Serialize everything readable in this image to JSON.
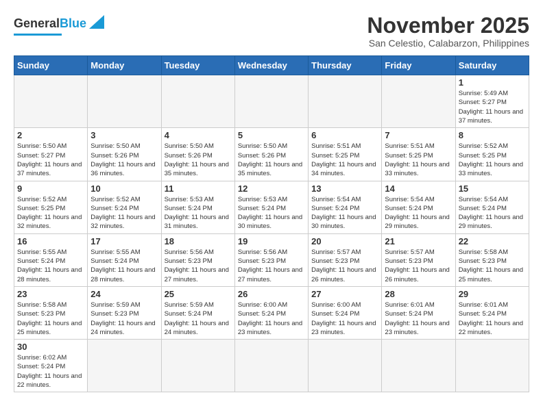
{
  "logo": {
    "text_general": "General",
    "text_blue": "Blue"
  },
  "title": "November 2025",
  "subtitle": "San Celestio, Calabarzon, Philippines",
  "weekdays": [
    "Sunday",
    "Monday",
    "Tuesday",
    "Wednesday",
    "Thursday",
    "Friday",
    "Saturday"
  ],
  "weeks": [
    [
      {
        "day": "",
        "empty": true
      },
      {
        "day": "",
        "empty": true
      },
      {
        "day": "",
        "empty": true
      },
      {
        "day": "",
        "empty": true
      },
      {
        "day": "",
        "empty": true
      },
      {
        "day": "",
        "empty": true
      },
      {
        "day": "1",
        "sunrise": "5:49 AM",
        "sunset": "5:27 PM",
        "daylight": "11 hours and 37 minutes."
      }
    ],
    [
      {
        "day": "2",
        "sunrise": "5:50 AM",
        "sunset": "5:27 PM",
        "daylight": "11 hours and 37 minutes."
      },
      {
        "day": "3",
        "sunrise": "5:50 AM",
        "sunset": "5:26 PM",
        "daylight": "11 hours and 36 minutes."
      },
      {
        "day": "4",
        "sunrise": "5:50 AM",
        "sunset": "5:26 PM",
        "daylight": "11 hours and 35 minutes."
      },
      {
        "day": "5",
        "sunrise": "5:50 AM",
        "sunset": "5:26 PM",
        "daylight": "11 hours and 35 minutes."
      },
      {
        "day": "6",
        "sunrise": "5:51 AM",
        "sunset": "5:25 PM",
        "daylight": "11 hours and 34 minutes."
      },
      {
        "day": "7",
        "sunrise": "5:51 AM",
        "sunset": "5:25 PM",
        "daylight": "11 hours and 33 minutes."
      },
      {
        "day": "8",
        "sunrise": "5:52 AM",
        "sunset": "5:25 PM",
        "daylight": "11 hours and 33 minutes."
      }
    ],
    [
      {
        "day": "9",
        "sunrise": "5:52 AM",
        "sunset": "5:25 PM",
        "daylight": "11 hours and 32 minutes."
      },
      {
        "day": "10",
        "sunrise": "5:52 AM",
        "sunset": "5:24 PM",
        "daylight": "11 hours and 32 minutes."
      },
      {
        "day": "11",
        "sunrise": "5:53 AM",
        "sunset": "5:24 PM",
        "daylight": "11 hours and 31 minutes."
      },
      {
        "day": "12",
        "sunrise": "5:53 AM",
        "sunset": "5:24 PM",
        "daylight": "11 hours and 30 minutes."
      },
      {
        "day": "13",
        "sunrise": "5:54 AM",
        "sunset": "5:24 PM",
        "daylight": "11 hours and 30 minutes."
      },
      {
        "day": "14",
        "sunrise": "5:54 AM",
        "sunset": "5:24 PM",
        "daylight": "11 hours and 29 minutes."
      },
      {
        "day": "15",
        "sunrise": "5:54 AM",
        "sunset": "5:24 PM",
        "daylight": "11 hours and 29 minutes."
      }
    ],
    [
      {
        "day": "16",
        "sunrise": "5:55 AM",
        "sunset": "5:24 PM",
        "daylight": "11 hours and 28 minutes."
      },
      {
        "day": "17",
        "sunrise": "5:55 AM",
        "sunset": "5:24 PM",
        "daylight": "11 hours and 28 minutes."
      },
      {
        "day": "18",
        "sunrise": "5:56 AM",
        "sunset": "5:23 PM",
        "daylight": "11 hours and 27 minutes."
      },
      {
        "day": "19",
        "sunrise": "5:56 AM",
        "sunset": "5:23 PM",
        "daylight": "11 hours and 27 minutes."
      },
      {
        "day": "20",
        "sunrise": "5:57 AM",
        "sunset": "5:23 PM",
        "daylight": "11 hours and 26 minutes."
      },
      {
        "day": "21",
        "sunrise": "5:57 AM",
        "sunset": "5:23 PM",
        "daylight": "11 hours and 26 minutes."
      },
      {
        "day": "22",
        "sunrise": "5:58 AM",
        "sunset": "5:23 PM",
        "daylight": "11 hours and 25 minutes."
      }
    ],
    [
      {
        "day": "23",
        "sunrise": "5:58 AM",
        "sunset": "5:23 PM",
        "daylight": "11 hours and 25 minutes."
      },
      {
        "day": "24",
        "sunrise": "5:59 AM",
        "sunset": "5:23 PM",
        "daylight": "11 hours and 24 minutes."
      },
      {
        "day": "25",
        "sunrise": "5:59 AM",
        "sunset": "5:24 PM",
        "daylight": "11 hours and 24 minutes."
      },
      {
        "day": "26",
        "sunrise": "6:00 AM",
        "sunset": "5:24 PM",
        "daylight": "11 hours and 23 minutes."
      },
      {
        "day": "27",
        "sunrise": "6:00 AM",
        "sunset": "5:24 PM",
        "daylight": "11 hours and 23 minutes."
      },
      {
        "day": "28",
        "sunrise": "6:01 AM",
        "sunset": "5:24 PM",
        "daylight": "11 hours and 23 minutes."
      },
      {
        "day": "29",
        "sunrise": "6:01 AM",
        "sunset": "5:24 PM",
        "daylight": "11 hours and 22 minutes."
      }
    ],
    [
      {
        "day": "30",
        "sunrise": "6:02 AM",
        "sunset": "5:24 PM",
        "daylight": "11 hours and 22 minutes."
      },
      {
        "day": "",
        "empty": true
      },
      {
        "day": "",
        "empty": true
      },
      {
        "day": "",
        "empty": true
      },
      {
        "day": "",
        "empty": true
      },
      {
        "day": "",
        "empty": true
      },
      {
        "day": "",
        "empty": true
      }
    ]
  ],
  "labels": {
    "sunrise_prefix": "Sunrise: ",
    "sunset_prefix": "Sunset: ",
    "daylight_prefix": "Daylight: "
  }
}
